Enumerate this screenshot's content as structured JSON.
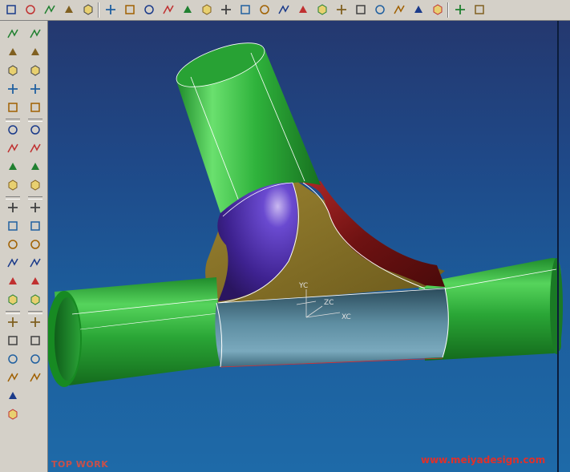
{
  "toolbar": {
    "icons": [
      "point-icon",
      "line-icon",
      "arc-icon",
      "rectangle-sketch-icon",
      "spline-icon",
      "point-set-icon",
      "curve-fit-icon",
      "polyline-icon",
      "rectangle-icon",
      "circle-icon",
      "circle-center-icon",
      "helix-icon",
      "law-curve-icon",
      "offset-curve-icon",
      "bridge-curve-icon",
      "project-curve-icon",
      "intersection-curve-icon",
      "section-curve-icon",
      "extract-curve-icon",
      "isoparametric-icon",
      "wrap-icon",
      "edit-feature-icon",
      "surface-shading-icon",
      "layer-icon",
      "analysis-icon"
    ]
  },
  "left_toolbar": {
    "col1_icons": [
      "sketch-icon",
      "sweep-icon",
      "extrude-icon",
      "revolve-icon",
      "tube-icon",
      "hole-icon",
      "boss-icon",
      "pocket-icon",
      "pad-icon",
      "slot-icon",
      "groove-icon",
      "draft-icon",
      "offset-face-icon",
      "shell-icon",
      "thread-icon",
      "edit-parameters-icon",
      "move-object-icon",
      "block-icon",
      "cylinder-icon",
      "cone-icon",
      "sphere-icon"
    ],
    "col2_icons": [
      "block-wire-icon",
      "cube-icon",
      "chamfer-icon",
      "edge-blend-icon",
      "face-blend-icon",
      "trim-body-icon",
      "split-body-icon",
      "pattern-icon",
      "mirror-icon",
      "sew-icon",
      "patch-icon",
      "scale-body-icon",
      "offset-surface-icon",
      "bounded-plane-icon",
      "thicken-icon",
      "extract-icon",
      "unite-icon",
      "subtract-icon",
      "intersect-icon"
    ]
  },
  "viewport": {
    "background_top": "#24386f",
    "background_bottom": "#1e6aa8",
    "triad": {
      "y_label": "YC",
      "z_label": "ZC",
      "x_label": "XC"
    },
    "watermark_left": "TOP WORK",
    "watermark_right": "www.meiyadesign.com"
  },
  "colors": {
    "pipe_green": "#2ea83a",
    "saddle_purple": "#4a2aa0",
    "saddle_red": "#8a1a1a",
    "gusset_olive": "#7a6a20",
    "sleeve_steel": "#4f7f94"
  }
}
